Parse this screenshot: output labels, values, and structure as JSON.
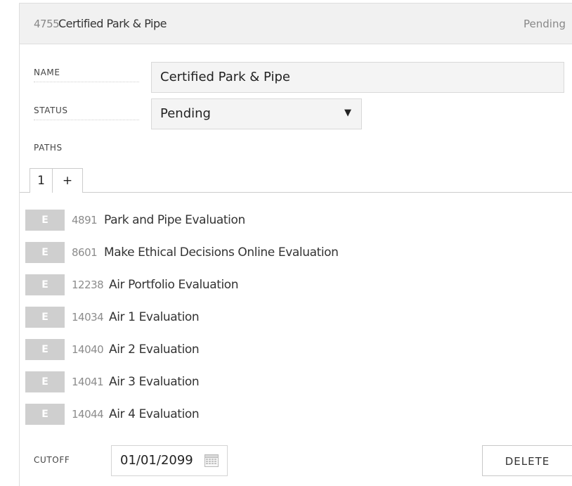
{
  "header": {
    "id": "4755",
    "title": "Certified Park & Pipe",
    "status": "Pending"
  },
  "fields": {
    "name_label": "NAME",
    "name_value": "Certified Park & Pipe",
    "status_label": "STATUS",
    "status_value": "Pending",
    "paths_label": "PATHS"
  },
  "tabs": [
    {
      "label": "1"
    },
    {
      "label": "+"
    }
  ],
  "items": [
    {
      "badge": "E",
      "id": "4891",
      "name": "Park and Pipe Evaluation"
    },
    {
      "badge": "E",
      "id": "8601",
      "name": "Make Ethical Decisions Online Evaluation"
    },
    {
      "badge": "E",
      "id": "12238",
      "name": "Air Portfolio Evaluation"
    },
    {
      "badge": "E",
      "id": "14034",
      "name": "Air 1 Evaluation"
    },
    {
      "badge": "E",
      "id": "14040",
      "name": "Air 2 Evaluation"
    },
    {
      "badge": "E",
      "id": "14041",
      "name": "Air 3 Evaluation"
    },
    {
      "badge": "E",
      "id": "14044",
      "name": "Air 4 Evaluation"
    }
  ],
  "footer": {
    "cutoff_label": "CUTOFF",
    "cutoff_value": "01/01/2099",
    "delete_label": "DELETE"
  },
  "icons": {
    "calendar": "calendar-icon",
    "dropdown": "dropdown-arrow-icon"
  }
}
